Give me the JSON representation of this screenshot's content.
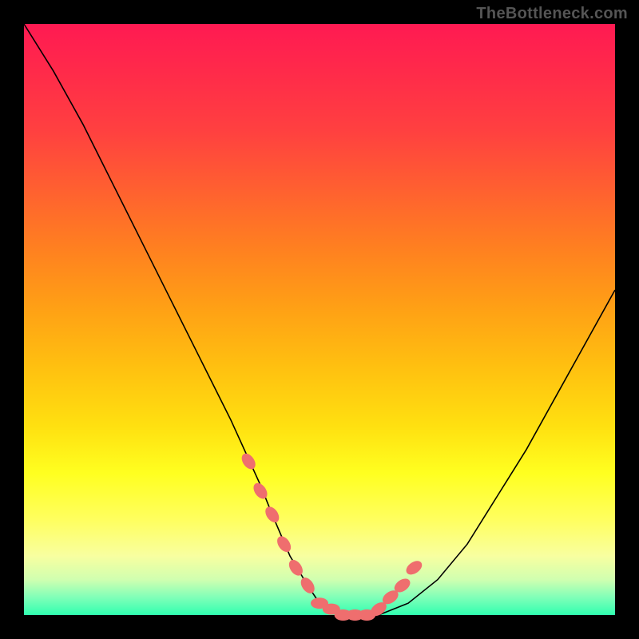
{
  "watermark": "TheBottleneck.com",
  "chart_data": {
    "type": "line",
    "title": "",
    "xlabel": "",
    "ylabel": "",
    "xlim": [
      0,
      100
    ],
    "ylim": [
      0,
      100
    ],
    "series": [
      {
        "name": "main-curve",
        "x": [
          0,
          5,
          10,
          15,
          20,
          25,
          30,
          35,
          40,
          42,
          45,
          48,
          50,
          52,
          55,
          58,
          60,
          65,
          70,
          75,
          80,
          85,
          90,
          95,
          100
        ],
        "y": [
          100,
          92,
          83,
          73,
          63,
          53,
          43,
          33,
          22,
          17,
          10,
          5,
          2,
          1,
          0,
          0,
          0,
          2,
          6,
          12,
          20,
          28,
          37,
          46,
          55
        ]
      },
      {
        "name": "highlight-dots",
        "x": [
          38,
          40,
          42,
          44,
          46,
          48,
          50,
          52,
          54,
          56,
          58,
          60,
          62,
          64,
          66
        ],
        "y": [
          26,
          21,
          17,
          12,
          8,
          5,
          2,
          1,
          0,
          0,
          0,
          1,
          3,
          5,
          8
        ]
      }
    ]
  }
}
